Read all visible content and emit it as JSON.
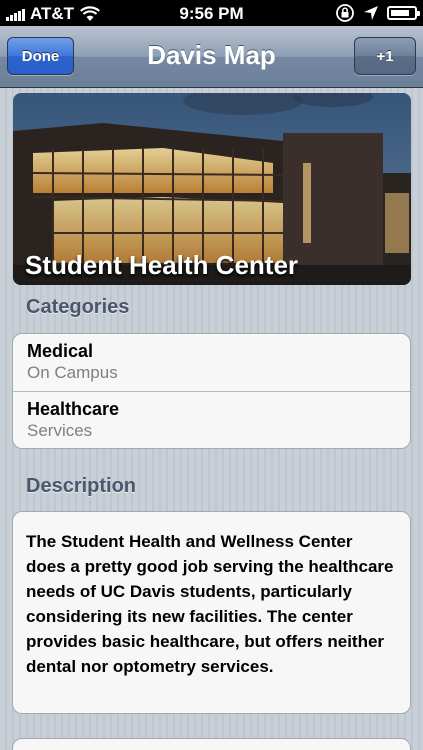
{
  "status_bar": {
    "carrier": "AT&T",
    "time": "9:56 PM",
    "battery_level": 0.8
  },
  "nav": {
    "title": "Davis Map",
    "done_label": "Done",
    "plus_label": "+1"
  },
  "hero": {
    "title": "Student Health Center"
  },
  "categories": {
    "header": "Categories",
    "items": [
      {
        "title": "Medical",
        "subtitle": "On Campus"
      },
      {
        "title": "Healthcare",
        "subtitle": "Services"
      }
    ]
  },
  "description": {
    "header": "Description",
    "text": "The Student Health and Wellness Center does a pretty good job serving the healthcare needs of UC Davis students, particularly considering its new facilities. The center provides basic healthcare, but offers neither dental nor optometry services."
  },
  "icons": {
    "signal": "signal-bars-icon",
    "wifi": "wifi-icon",
    "rotation_lock": "rotation-lock-icon",
    "location": "location-arrow-icon",
    "battery": "battery-icon"
  }
}
